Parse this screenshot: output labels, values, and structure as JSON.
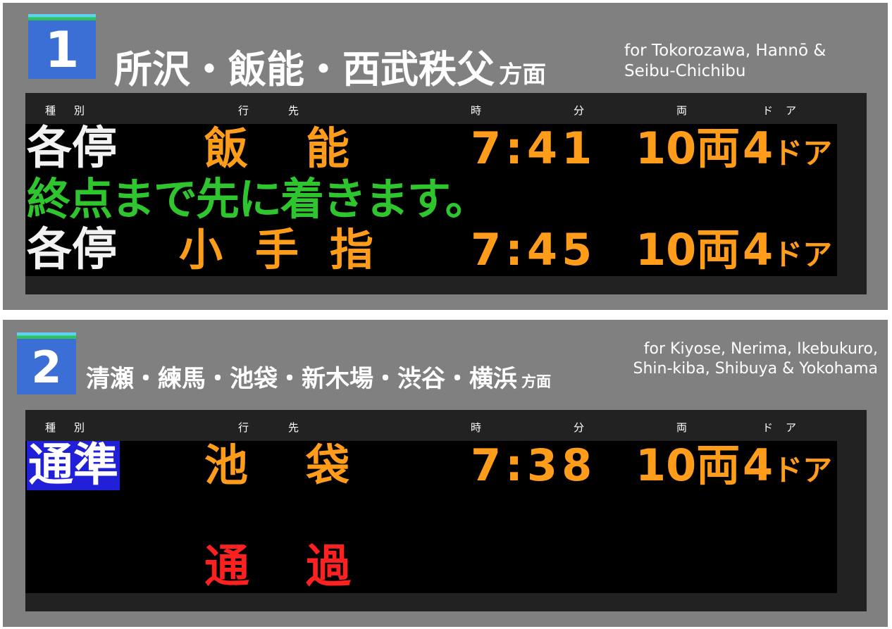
{
  "platform1": {
    "number": "1",
    "destination_ja": "所沢・飯能・西武秩父",
    "houmen": "方面",
    "destination_en_line1": "for Tokorozawa, Hannō &",
    "destination_en_line2": "Seibu-Chichibu",
    "headers": {
      "type": "種別",
      "destination": "行先",
      "hour": "時",
      "minute": "分",
      "cars": "両",
      "doors": "ドア"
    },
    "row1": {
      "type": "各停",
      "destination_a": "飯",
      "destination_b": "能",
      "time": "7:41",
      "cars": "10両",
      "doors_num": "4",
      "doors_suffix": "ドア"
    },
    "message": "終点まで先に着きます。",
    "row2": {
      "type": "各停",
      "destination_a": "小",
      "destination_b": "手",
      "destination_c": "指",
      "time": "7:45",
      "cars": "10両",
      "doors_num": "4",
      "doors_suffix": "ドア"
    }
  },
  "platform2": {
    "number": "2",
    "destination_ja": "清瀬・練馬・池袋・新木場・渋谷・横浜",
    "houmen": "方面",
    "destination_en_line1": "for Kiyose, Nerima, Ikebukuro,",
    "destination_en_line2": "Shin-kiba, Shibuya & Yokohama",
    "headers": {
      "type": "種別",
      "destination": "行先",
      "hour": "時",
      "minute": "分",
      "cars": "両",
      "doors": "ドア"
    },
    "row1": {
      "type": "通準",
      "destination_a": "池",
      "destination_b": "袋",
      "time": "7:38",
      "cars": "10両",
      "doors_num": "4",
      "doors_suffix": "ドア"
    },
    "pass": {
      "a": "通",
      "b": "過"
    }
  },
  "colors": {
    "panel_bg": "#808080",
    "badge_blue": "#3b6fd6",
    "led_orange": "#ff9d1a",
    "led_green": "#2ec52e",
    "led_red": "#ff2020",
    "led_white": "#f2f2f2",
    "tsujun_bg": "#2020d8"
  }
}
